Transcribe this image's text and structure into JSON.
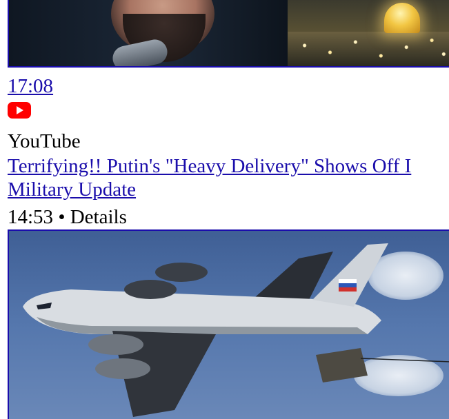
{
  "top_video": {
    "duration": "17:08",
    "thumbnail_icon": "video-thumbnail-person-and-city"
  },
  "result": {
    "source_icon": "youtube-icon",
    "source": "YouTube",
    "title_line1": "Terrifying!! Putin's \"Heavy Delivery\" Shows Off I",
    "title_line2": "Military Update",
    "duration": "14:53",
    "separator": "•",
    "details": "Details",
    "thumbnail_icon": "video-thumbnail-cargo-plane"
  },
  "colors": {
    "link": "#1a0dab",
    "youtube_red": "#ff0000"
  }
}
